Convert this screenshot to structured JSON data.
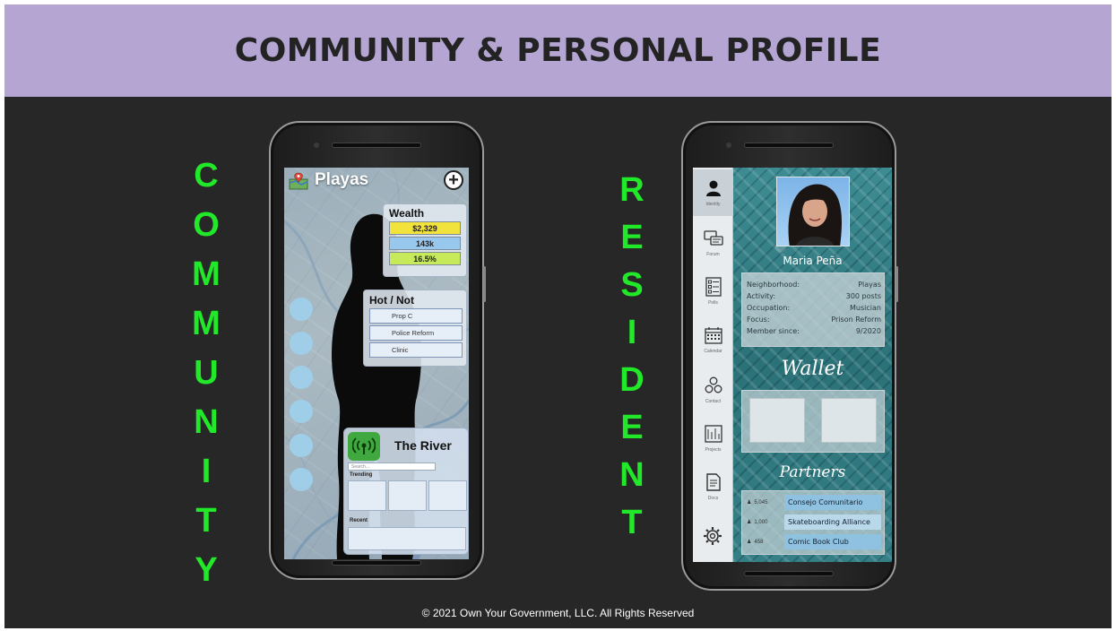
{
  "header": {
    "title": "COMMUNITY & PERSONAL PROFILE"
  },
  "left_label": [
    "C",
    "O",
    "M",
    "M",
    "U",
    "N",
    "I",
    "T",
    "Y"
  ],
  "right_label": [
    "R",
    "E",
    "S",
    "I",
    "D",
    "E",
    "N",
    "T"
  ],
  "community": {
    "place": "Playas",
    "wealth": {
      "title": "Wealth",
      "rows": [
        {
          "value": "$2,329",
          "color": "#f2e23c"
        },
        {
          "value": "143k",
          "color": "#99c8ee"
        },
        {
          "value": "16.5%",
          "color": "#c6ea5a"
        }
      ]
    },
    "hot_not": {
      "title": "Hot / Not",
      "items": [
        "Prop C",
        "Police Reform",
        "Clinic"
      ]
    },
    "river": {
      "title": "The River",
      "search_placeholder": "Search...",
      "trending_label": "Trending",
      "recent_label": "Recent"
    }
  },
  "resident": {
    "nav": [
      {
        "label": "Identity",
        "icon": "person-icon"
      },
      {
        "label": "Forum",
        "icon": "chat-icon"
      },
      {
        "label": "Polls",
        "icon": "checklist-icon"
      },
      {
        "label": "Calendar",
        "icon": "calendar-icon"
      },
      {
        "label": "Contact",
        "icon": "contacts-icon"
      },
      {
        "label": "Projects",
        "icon": "projects-icon"
      },
      {
        "label": "Docs",
        "icon": "document-icon"
      }
    ],
    "name": "Maria Peña",
    "info": [
      {
        "label": "Neighborhood:",
        "value": "Playas"
      },
      {
        "label": "Activity:",
        "value": "300 posts"
      },
      {
        "label": "Occupation:",
        "value": "Musician"
      },
      {
        "label": "Focus:",
        "value": "Prison Reform"
      },
      {
        "label": "Member since:",
        "value": "9/2020"
      }
    ],
    "wallet_title": "Wallet",
    "partners_title": "Partners",
    "partners": [
      {
        "count": "5,045",
        "name": "Consejo Comunitario"
      },
      {
        "count": "1,000",
        "name": "Skateboarding Alliance"
      },
      {
        "count": "458",
        "name": "Comic Book Club"
      }
    ]
  },
  "footer": {
    "text": "© 2021 Own Your Government, LLC.  All Rights Reserved"
  },
  "colors": {
    "title_bar": "#b4a5d3",
    "background": "#272727",
    "label_green": "#22e82a"
  }
}
